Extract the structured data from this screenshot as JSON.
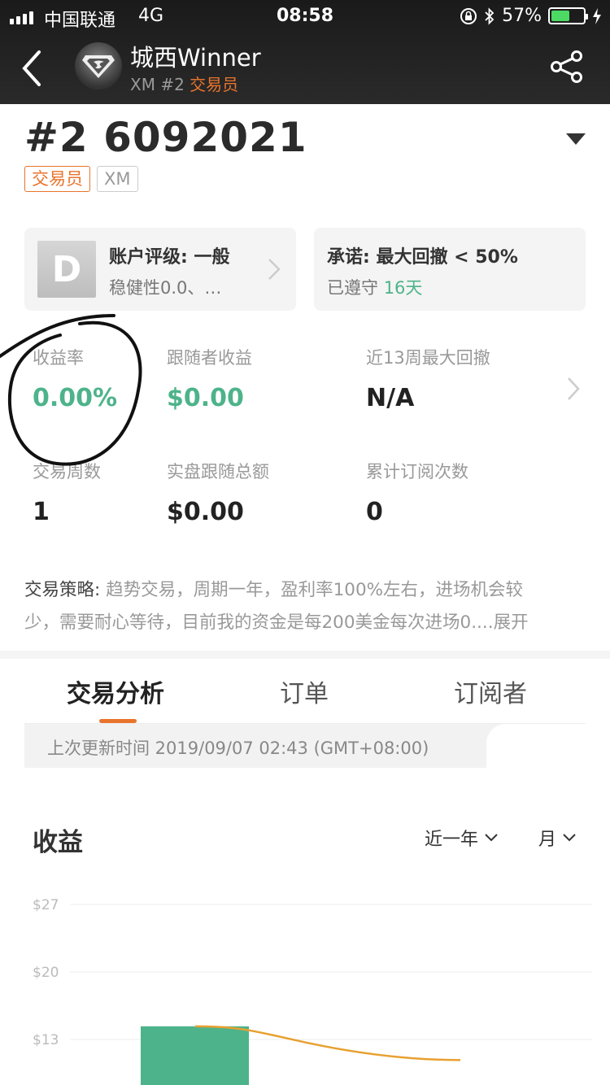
{
  "status_bar": {
    "carrier": "中国联通",
    "network": "4G",
    "time": "08:58",
    "battery_percent": "57%",
    "battery_level": 0.57
  },
  "header": {
    "user_name": "城西Winner",
    "broker": "XM",
    "rank": "#2",
    "role": "交易员"
  },
  "account": {
    "title": "#2 6092021",
    "tags": [
      "交易员",
      "XM"
    ]
  },
  "cards": {
    "rating": {
      "grade": "D",
      "title": "账户评级: 一般",
      "subtitle": "稳健性0.0、…"
    },
    "promise": {
      "title": "承诺: 最大回撤 < 50%",
      "kept_prefix": "已遵守",
      "kept_days": "16天"
    }
  },
  "stats": [
    {
      "label": "收益率",
      "value": "0.00%"
    },
    {
      "label": "跟随者收益",
      "value": "$0.00"
    },
    {
      "label": "近13周最大回撤",
      "value": "N/A"
    },
    {
      "label": "交易周数",
      "value": "1"
    },
    {
      "label": "实盘跟随总额",
      "value": "$0.00"
    },
    {
      "label": "累计订阅次数",
      "value": "0"
    }
  ],
  "strategy": {
    "label": "交易策略:",
    "text_line1": " 趋势交易，周期一年，盈利率100%左右，进场机会较",
    "text_line2": "少，需要耐心等待，目前我的资金是每200美金每次进场0....",
    "more": "展开"
  },
  "tabs": [
    "交易分析",
    "订单",
    "订阅者"
  ],
  "last_update": "上次更新时间 2019/09/07 02:43 (GMT+08:00)",
  "chart_section": {
    "title": "收益",
    "range_select": "近一年",
    "period_select": "月"
  },
  "colors": {
    "accent": "#e8742d",
    "positive": "#4db38a",
    "bar": "#4db38a",
    "line": "#e8a030"
  },
  "chart_data": {
    "type": "bar",
    "y_ticks": [
      "$27",
      "$20",
      "$13"
    ],
    "y_tick_values": [
      27,
      20,
      13
    ],
    "bars": [
      13.1
    ],
    "line": [
      13.1,
      9.6
    ],
    "grid": true
  }
}
